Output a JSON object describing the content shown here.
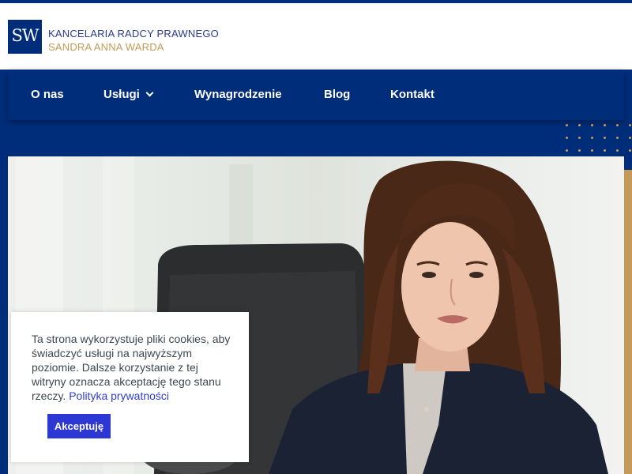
{
  "brand": {
    "logo_text": "SW",
    "line1": "KANCELARIA RADCY PRAWNEGO",
    "line2": "SANDRA ANNA WARDA"
  },
  "nav": {
    "items": [
      {
        "label": "O nas"
      },
      {
        "label": "Usługi",
        "has_dropdown": true
      },
      {
        "label": "Wynagrodzenie"
      },
      {
        "label": "Blog"
      },
      {
        "label": "Kontakt"
      }
    ]
  },
  "hero": {
    "image": "portrait photo of a woman with shoulder-length brown hair in a dark blazer, seated in an office"
  },
  "cookie_notice": {
    "text": "Ta strona wykorzystuje pliki cookies, aby świadczyć usługi na najwyższym poziomie. Dalsze korzystanie z tej witryny oznacza akceptację tego stanu rzeczy.",
    "link": "Polityka prywatności",
    "accept_button": "Akceptuję"
  },
  "colors": {
    "brand_navy": "#002d7a",
    "accent_gold": "#c49a5a",
    "button_blue": "#2c37d4"
  }
}
